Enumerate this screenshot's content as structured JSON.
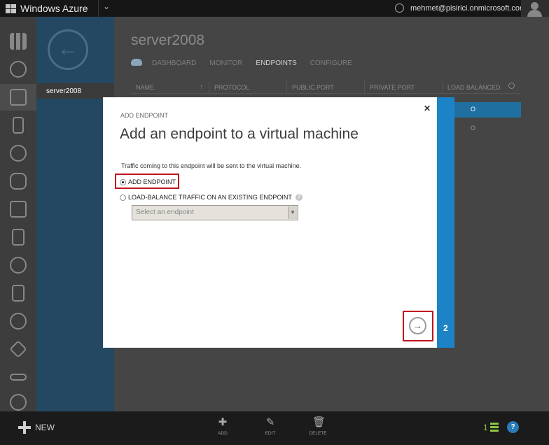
{
  "topbar": {
    "brand": "Windows Azure",
    "user_email": "mehmet@pisirici.onmicrosoft.com"
  },
  "subnav": {
    "item": "server2008"
  },
  "page": {
    "title": "server2008",
    "tabs": [
      "DASHBOARD",
      "MONITOR",
      "ENDPOINTS",
      "CONFIGURE"
    ],
    "active_tab": "ENDPOINTS"
  },
  "grid": {
    "columns": [
      "NAME",
      "PROTOCOL",
      "PUBLIC PORT",
      "PRIVATE PORT",
      "LOAD BALANCED"
    ]
  },
  "dialog": {
    "small_title": "ADD ENDPOINT",
    "title": "Add an endpoint to a virtual machine",
    "description": "Traffic coming to this endpoint will be sent to the virtual machine.",
    "option_add": "ADD ENDPOINT",
    "option_lb": "LOAD-BALANCE TRAFFIC ON AN EXISTING ENDPOINT",
    "select_placeholder": "Select an endpoint",
    "step": "2",
    "selected_option": "ADD ENDPOINT"
  },
  "bottombar": {
    "new_label": "NEW",
    "commands": [
      "ADD",
      "EDIT",
      "DELETE"
    ],
    "notifications": "1"
  },
  "colors": {
    "accent_blue": "#1c84c6",
    "highlight_red": "#c0131f",
    "subnav_bg": "#244861"
  }
}
